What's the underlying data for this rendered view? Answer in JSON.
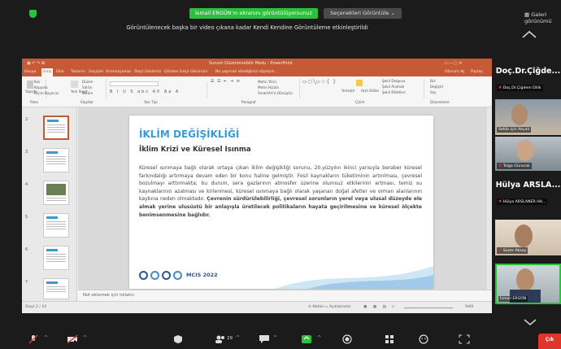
{
  "meeting": {
    "share_banner": "İsmail ERGÜN'ın ekranını görüntülüyorsunuz",
    "view_options": "Seçenekleri Görüntüle ⌄",
    "gallery_view": "Galeri görünümü",
    "share_notice": "Görüntülenecek başka bir video çıkana kadar Kendi Kendine Görüntüleme etkinleştirildi"
  },
  "ppt": {
    "title_bar": "Sunum Düzenlenebilir Modu - PowerPoint",
    "user": "Oturum Aç",
    "share": "Paylaş",
    "tabs": [
      "Dosya",
      "Giriş",
      "Ekle",
      "Tasarım",
      "Geçişler",
      "Animasyonlar",
      "Slayt Gösterisi",
      "Gözden Geçir",
      "Görünüm",
      "Ne yapmak istediğinizi söyleyin..."
    ],
    "ribbon_groups": [
      "Pano",
      "Slaytlar",
      "Yazı Tipi",
      "Paragraf",
      "Çizim",
      "Düzenleme"
    ],
    "ribbon_items": [
      "Kes",
      "Kopyala",
      "Biçim Boyacısı",
      "Yapıştır",
      "Düzen",
      "Sıfırla",
      "Bölüm",
      "Yeni Slayt",
      "Metin Yönü",
      "Metni Hizala",
      "SmartArt'a Dönüştür",
      "Yerleştir",
      "Hızlı Stiller",
      "Şekil Dolgusu",
      "Şekil Anahatı",
      "Şekil Efektleri",
      "Bul",
      "Değiştir",
      "Seç"
    ],
    "slide_numbers": [
      "2",
      "3",
      "4",
      "5",
      "6",
      "7"
    ],
    "notes": "Not eklemek için tıklatın",
    "status_left": "Slayt 2 / 10",
    "status_notes": "Notlar",
    "status_comments": "Açıklamalar",
    "zoom": "%69"
  },
  "slide": {
    "title": "İKLİM DEĞİŞİKLİĞİ",
    "subtitle": "İklim Krizi ve Küresel Isınma",
    "body_plain": "Küresel ısınmaya bağlı olarak ortaya çıkan iklim değişikliği sorunu, 20.yüzyılın ikinci yarısıyla beraber küresel farkındalığı artırmaya devam eden bir konu haline gelmiştir. Fosil kaynakların tüketiminin artırılması, çevresel bozulmayı arttırmakta; bu durum, sera gazlarının atmosfer üzerine olumsuz etkilerinin artması, temiz su kaynaklarının azalması ve kirlenmesi, küresel ısınmaya bağlı olarak yaşanan doğal afetler ve orman alanlarının kaybına neden olmaktadır.",
    "body_bold": "Çevrenin sürdürülebilirliği, çevresel sorunların yerel veya ulusal düzeyde ele almak yerine ulusüstü bir anlayışla üretilecek politikaların hayata geçirilmesine ve küresel ölçekte benimsenmesine bağlıdır.",
    "logo_text": "MCIS 2022"
  },
  "participants": {
    "big_1": "Doç.Dr.Çiğde...",
    "label_1": "Doç.Dr.Çiğdem Dilik",
    "label_2": "Selda için Akçalı",
    "label_3": "Tolga Gürocak",
    "big_2": "Hülya ARSLA...",
    "label_4": "Hülya ARSLANER HA...",
    "label_5": "Sezer Aksoy",
    "label_6": "İsmail ERGÜN"
  },
  "toolbar": {
    "participants_count": "29",
    "end": "Çık"
  },
  "colors": {
    "ppt_accent": "#c55a35",
    "slide_title": "#3a9bd4",
    "share_green": "#2fbf3e",
    "end_red": "#e0342c"
  }
}
